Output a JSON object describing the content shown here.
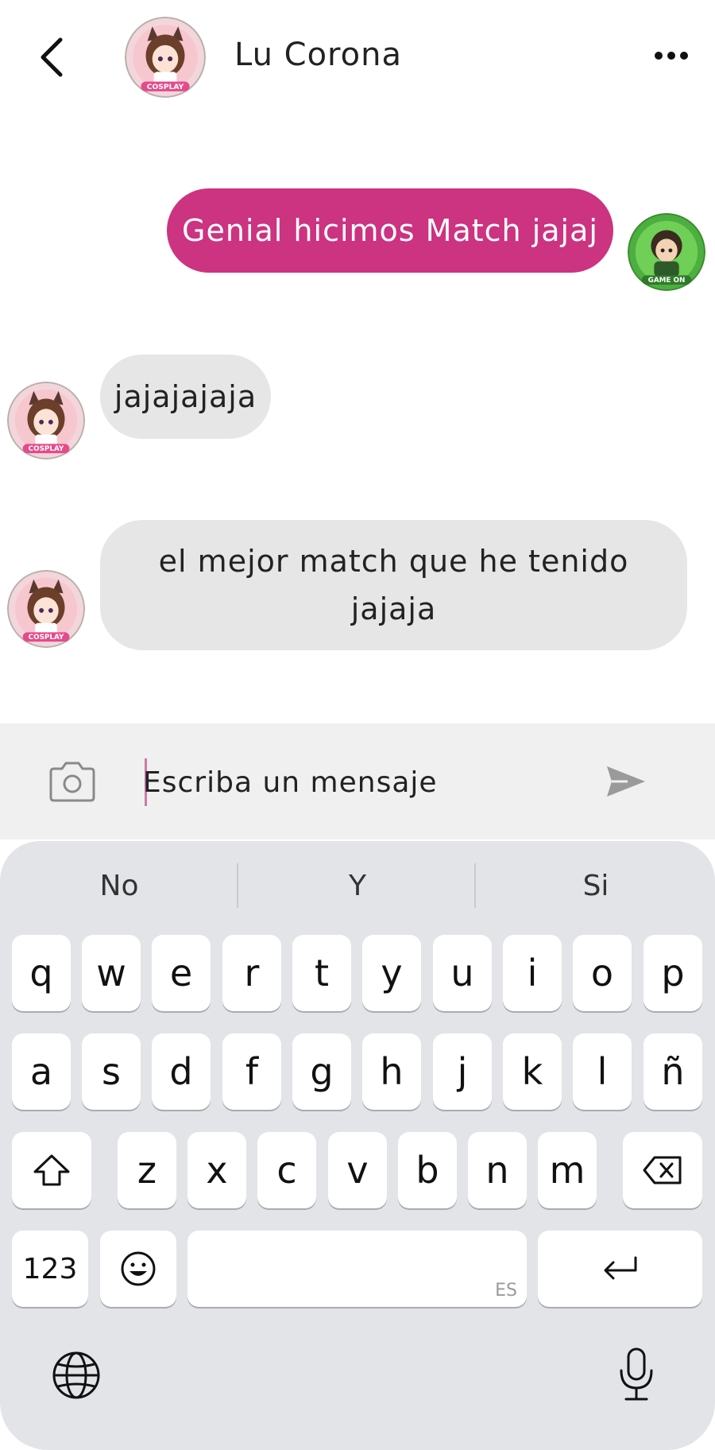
{
  "header": {
    "contact_name": "Lu Corona",
    "contact_avatar_label": "COSPLAY"
  },
  "messages": [
    {
      "direction": "sent",
      "text": "Genial hicimos Match jajaj",
      "avatar_label": "GAME ON"
    },
    {
      "direction": "received",
      "text": "jajajajaja",
      "avatar_label": "COSPLAY"
    },
    {
      "direction": "received",
      "text": "el mejor match que he tenido jajaja",
      "avatar_label": "COSPLAY"
    }
  ],
  "composer": {
    "placeholder": "Escriba un mensaje"
  },
  "keyboard": {
    "suggestions": [
      "No",
      "Y",
      "Si"
    ],
    "row1": [
      "q",
      "w",
      "e",
      "r",
      "t",
      "y",
      "u",
      "i",
      "o",
      "p"
    ],
    "row2": [
      "a",
      "s",
      "d",
      "f",
      "g",
      "h",
      "j",
      "k",
      "l",
      "ñ"
    ],
    "row3": [
      "z",
      "x",
      "c",
      "v",
      "b",
      "n",
      "m"
    ],
    "numbers_label": "123",
    "space_lang_label": "ES"
  },
  "colors": {
    "accent": "#cc3380",
    "received_bubble": "#e6e6e6",
    "input_bar": "#f0f0f0",
    "keyboard_bg": "#e3e4e8"
  }
}
